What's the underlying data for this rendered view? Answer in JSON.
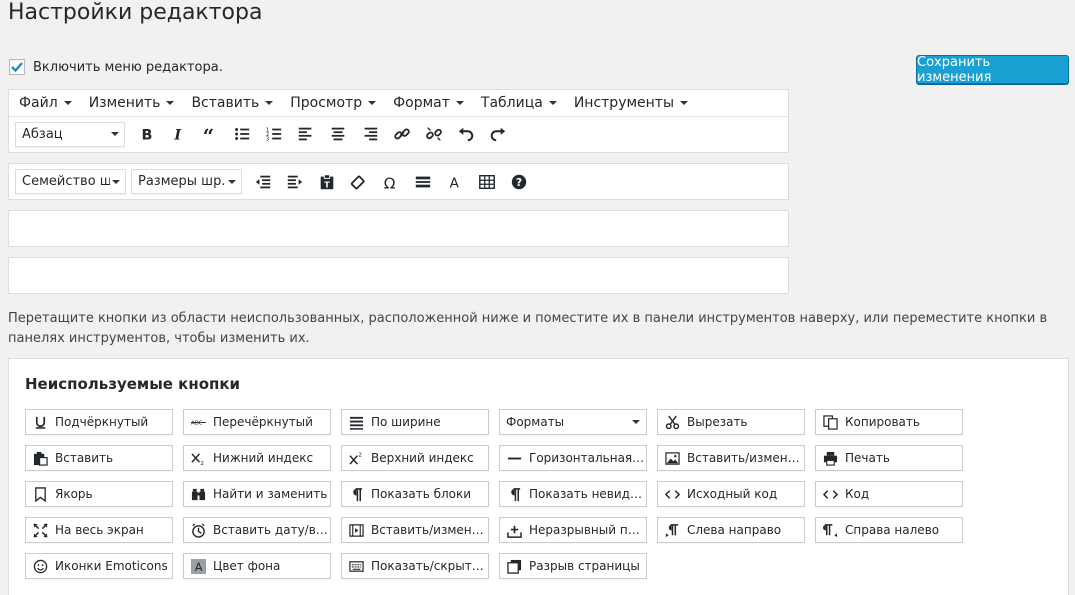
{
  "page": {
    "title": "Настройки редактора"
  },
  "enable": {
    "label": "Включить меню редактора.",
    "checked": true
  },
  "save_button": {
    "label": "Сохранить изменения"
  },
  "menubar": {
    "items": [
      {
        "label": "Файл"
      },
      {
        "label": "Изменить"
      },
      {
        "label": "Вставить"
      },
      {
        "label": "Просмотр"
      },
      {
        "label": "Формат"
      },
      {
        "label": "Таблица"
      },
      {
        "label": "Инструменты"
      }
    ]
  },
  "toolbar1": {
    "format_select": "Абзац",
    "icons": [
      "bold-icon",
      "italic-icon",
      "blockquote-icon",
      "bullet-list-icon",
      "numbered-list-icon",
      "align-left-icon",
      "align-center-icon",
      "align-right-icon",
      "link-icon",
      "unlink-icon",
      "undo-icon",
      "redo-icon"
    ]
  },
  "toolbar2": {
    "font_family_select": "Семейство ш...",
    "font_size_select": "Размеры шр...",
    "icons": [
      "outdent-icon",
      "indent-icon",
      "paste-text-icon",
      "clear-formatting-icon",
      "special-char-icon",
      "horizontal-rule-icon",
      "text-color-icon",
      "table-icon",
      "help-icon"
    ]
  },
  "help_text": "Перетащите кнопки из области неиспользованных, расположенной ниже и поместите их в панели инструментов наверху, или переместите кнопки в панелях инструментов, чтобы изменить их.",
  "unused": {
    "title": "Неиспользуемые кнопки",
    "buttons": [
      {
        "label": "Подчёркнутый",
        "icon": "underline-icon"
      },
      {
        "label": "Перечёркнутый",
        "icon": "strikethrough-icon"
      },
      {
        "label": "По ширине",
        "icon": "align-justify-icon"
      },
      {
        "label": "Форматы",
        "icon": "dropdown"
      },
      {
        "label": "Вырезать",
        "icon": "scissors-icon"
      },
      {
        "label": "Копировать",
        "icon": "copy-icon"
      },
      {
        "label": "Вставить",
        "icon": "paste-icon"
      },
      {
        "label": "Нижний индекс",
        "icon": "subscript-icon"
      },
      {
        "label": "Верхний индекс",
        "icon": "superscript-icon"
      },
      {
        "label": "Горизонтальная ли...",
        "icon": "hr-icon"
      },
      {
        "label": "Вставить/изменить ...",
        "icon": "image-icon"
      },
      {
        "label": "Печать",
        "icon": "print-icon"
      },
      {
        "label": "Якорь",
        "icon": "bookmark-icon"
      },
      {
        "label": "Найти и заменить",
        "icon": "binoculars-icon"
      },
      {
        "label": "Показать блоки",
        "icon": "pilcrow-icon"
      },
      {
        "label": "Показать невидимы...",
        "icon": "pilcrow-icon"
      },
      {
        "label": "Исходный код",
        "icon": "code-icon"
      },
      {
        "label": "Код",
        "icon": "code-icon"
      },
      {
        "label": "На весь экран",
        "icon": "fullscreen-icon"
      },
      {
        "label": "Вставить дату/время",
        "icon": "clock-icon"
      },
      {
        "label": "Вставить/изменить ...",
        "icon": "media-icon"
      },
      {
        "label": "Неразрывный проб...",
        "icon": "nbsp-icon"
      },
      {
        "label": "Слева направо",
        "icon": "ltr-icon"
      },
      {
        "label": "Справа налево",
        "icon": "rtl-icon"
      },
      {
        "label": "Иконки Emoticons",
        "icon": "smiley-icon"
      },
      {
        "label": "Цвет фона",
        "icon": "bgcolor-icon"
      },
      {
        "label": "Показать/скрыть п...",
        "icon": "keyboard-icon"
      },
      {
        "label": "Разрыв страницы",
        "icon": "pagebreak-icon"
      }
    ]
  },
  "colors": {
    "accent": "#1ba0d3",
    "checkmark": "#1e8cbe"
  }
}
